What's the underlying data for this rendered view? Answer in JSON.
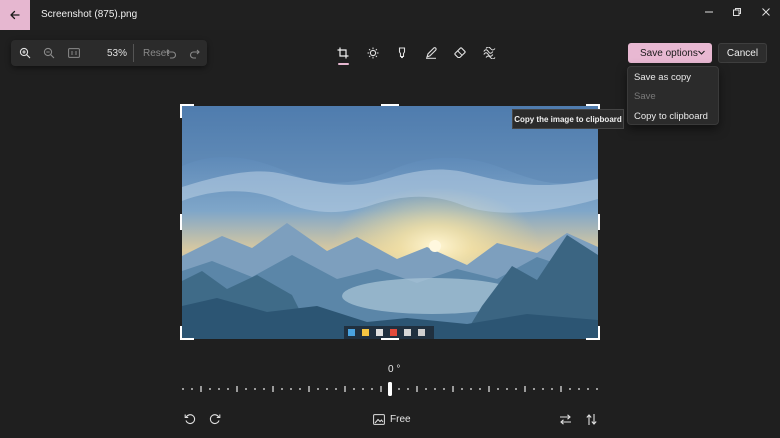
{
  "window": {
    "title": "Screenshot (875).png"
  },
  "zoom": {
    "level": "53%",
    "reset_label": "Reset"
  },
  "tools": [
    "crop-icon",
    "adjust-brightness-icon",
    "markup-icon",
    "draw-icon",
    "erase-icon",
    "filter-icon"
  ],
  "actions": {
    "save_options_label": "Save options",
    "cancel_label": "Cancel"
  },
  "save_menu": {
    "items": [
      {
        "label": "Save as copy",
        "enabled": true
      },
      {
        "label": "Save",
        "enabled": false
      },
      {
        "label": "Copy to clipboard",
        "enabled": true
      }
    ]
  },
  "tooltip": {
    "text": "Copy the image to clipboard"
  },
  "rotation": {
    "value": "0 °"
  },
  "aspect": {
    "label": "Free"
  },
  "colors": {
    "accent": "#e8b8d2",
    "background": "#1f1f1f",
    "panel": "#2b2b2b"
  }
}
